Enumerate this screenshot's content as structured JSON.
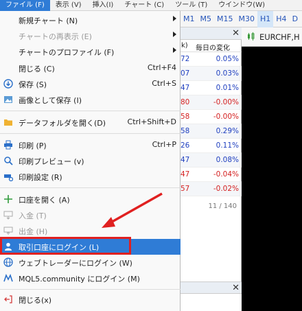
{
  "menubar": [
    {
      "label": "ファイル (F)",
      "active": true
    },
    {
      "label": "表示 (V)"
    },
    {
      "label": "挿入(I)"
    },
    {
      "label": "チャート (C)"
    },
    {
      "label": "ツール (T)"
    },
    {
      "label": "ウインドウ(W)"
    }
  ],
  "timeframes": [
    "M1",
    "M5",
    "M15",
    "M30",
    "H1",
    "H4",
    "D"
  ],
  "selected_timeframe": "H1",
  "market_watch": {
    "col_partial": "k)",
    "col_change": "毎日の変化",
    "rows": [
      {
        "bid": "72",
        "change": "0.05%",
        "color": "#1f3fbf"
      },
      {
        "bid": "07",
        "change": "0.03%",
        "color": "#1f3fbf"
      },
      {
        "bid": "47",
        "change": "0.01%",
        "color": "#1f3fbf"
      },
      {
        "bid": "80",
        "change": "-0.00%",
        "color": "#d42020"
      },
      {
        "bid": "58",
        "change": "-0.00%",
        "color": "#d42020"
      },
      {
        "bid": "58",
        "change": "0.29%",
        "color": "#1f3fbf"
      },
      {
        "bid": "26",
        "change": "0.11%",
        "color": "#1f3fbf"
      },
      {
        "bid": "47",
        "change": "0.08%",
        "color": "#1f3fbf"
      },
      {
        "bid": "47",
        "change": "-0.04%",
        "color": "#d42020"
      },
      {
        "bid": "57",
        "change": "-0.02%",
        "color": "#d42020"
      }
    ],
    "count": "11 / 140",
    "close": "✕"
  },
  "chart_window": {
    "title": "EURCHF,H"
  },
  "menu": {
    "items": [
      {
        "label": "新規チャート (N)",
        "arrow": true
      },
      {
        "label": "チャートの再表示 (E)",
        "arrow": true,
        "disabled": true
      },
      {
        "label": "チャートのプロファイル (F)",
        "arrow": true
      },
      {
        "label": "閉じる (C)",
        "shortcut": "Ctrl+F4"
      },
      {
        "label": "保存 (S)",
        "shortcut": "Ctrl+S",
        "icon": "save-icon"
      },
      {
        "label": "画像として保存 (I)",
        "icon": "image-icon"
      },
      {
        "label": "データフォルダを開く(D)",
        "shortcut": "Ctrl+Shift+D",
        "icon": "folder-icon"
      },
      {
        "label": "印刷 (P)",
        "shortcut": "Ctrl+P",
        "icon": "print-icon"
      },
      {
        "label": "印刷プレビュー (v)",
        "icon": "print-preview-icon"
      },
      {
        "label": "印刷設定 (R)",
        "icon": "print-settings-icon"
      },
      {
        "label": "口座を開く (A)",
        "icon": "plus-icon"
      },
      {
        "label": "入金 (T)",
        "disabled": true,
        "icon": "deposit-icon"
      },
      {
        "label": "出金 (H)",
        "disabled": true,
        "icon": "withdraw-icon"
      },
      {
        "label": "取引口座にログイン (L)",
        "highlighted": true,
        "icon": "user-icon"
      },
      {
        "label": "ウェブトレーダーにログイン (W)",
        "icon": "globe-icon"
      },
      {
        "label": "MQL5.community にログイン (M)",
        "icon": "mql5-icon"
      },
      {
        "label": "閉じる(x)",
        "icon": "exit-icon"
      }
    ]
  },
  "colors": {
    "accent": "#2f7cd6",
    "annotation": "#e02020"
  }
}
